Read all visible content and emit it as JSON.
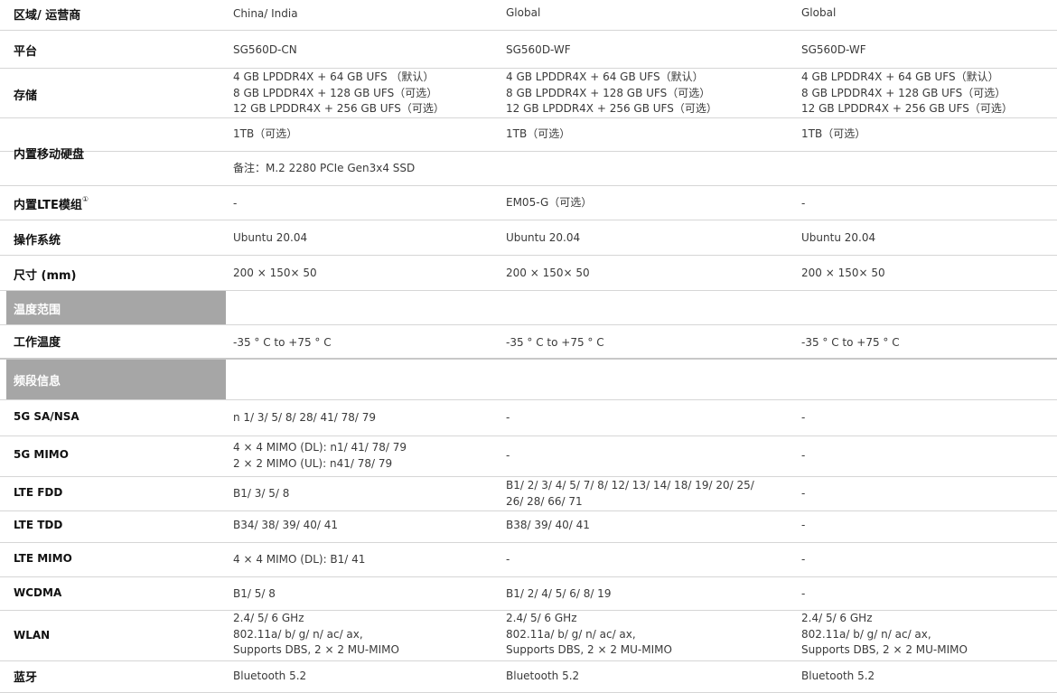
{
  "rows": {
    "region": {
      "label": "区域/ 运营商",
      "c1": "China/ India",
      "c2": "Global",
      "c3": "Global"
    },
    "platform": {
      "label": "平台",
      "c1": "SG560D-CN",
      "c2": "SG560D-WF",
      "c3": "SG560D-WF"
    },
    "storage": {
      "label": "存储",
      "c1": [
        "4 GB LPDDR4X + 64 GB UFS （默认）",
        "8 GB LPDDR4X + 128 GB UFS（可选）",
        "12 GB LPDDR4X + 256 GB UFS（可选）"
      ],
      "c2": [
        "4 GB LPDDR4X + 64 GB UFS（默认）",
        "8 GB LPDDR4X + 128 GB UFS（可选）",
        "12 GB LPDDR4X + 256 GB UFS（可选）"
      ],
      "c3": [
        "4 GB LPDDR4X + 64 GB UFS（默认）",
        "8 GB LPDDR4X + 128 GB UFS（可选）",
        "12 GB LPDDR4X + 256 GB UFS（可选）"
      ]
    },
    "disk": {
      "label": "内置移动硬盘",
      "c1": "1TB（可选）",
      "c2": "1TB（可选）",
      "c3": "1TB（可选）",
      "note": "备注：M.2 2280 PCIe Gen3x4 SSD"
    },
    "lte_module": {
      "label": "内置LTE模组",
      "mark": "①",
      "c1": "-",
      "c2": "EM05-G（可选）",
      "c3": "-"
    },
    "os": {
      "label": "操作系统",
      "c1": "Ubuntu 20.04",
      "c2": "Ubuntu 20.04",
      "c3": "Ubuntu 20.04"
    },
    "size": {
      "label": "尺寸 (mm)",
      "c1": "200 × 150× 50",
      "c2": "200 × 150× 50",
      "c3": "200 × 150× 50"
    },
    "temp_section": {
      "label": "温度范围"
    },
    "work_temp": {
      "label": "工作温度",
      "c1": "-35 ° C to +75 ° C",
      "c2": "-35 ° C to +75 ° C",
      "c3": "-35 ° C to +75 ° C"
    },
    "band_section": {
      "label": "频段信息"
    },
    "sa_nsa": {
      "label": "5G SA/NSA",
      "c1": "n 1/ 3/ 5/ 8/ 28/ 41/ 78/ 79",
      "c2": "-",
      "c3": "-"
    },
    "mimo5g": {
      "label": "5G MIMO",
      "c1": [
        "4 × 4 MIMO (DL): n1/ 41/ 78/ 79",
        "2 × 2 MIMO (UL): n41/ 78/ 79"
      ],
      "c2": "-",
      "c3": "-"
    },
    "lte_fdd": {
      "label": "LTE FDD",
      "c1": "B1/ 3/ 5/ 8",
      "c2": [
        "B1/ 2/ 3/ 4/ 5/ 7/ 8/ 12/ 13/ 14/ 18/ 19/ 20/ 25/",
        "26/  28/ 66/ 71"
      ],
      "c3": "-"
    },
    "lte_tdd": {
      "label": "LTE TDD",
      "c1": "B34/ 38/ 39/ 40/ 41",
      "c2": "B38/ 39/ 40/ 41",
      "c3": "-"
    },
    "lte_mimo": {
      "label": "LTE MIMO",
      "c1": "4 × 4 MIMO (DL): B1/ 41",
      "c2": "-",
      "c3": "-"
    },
    "wcdma": {
      "label": "WCDMA",
      "c1": "B1/ 5/ 8",
      "c2": "B1/ 2/ 4/ 5/ 6/ 8/ 19",
      "c3": "-"
    },
    "wlan": {
      "label": "WLAN",
      "c1": [
        "2.4/ 5/ 6 GHz",
        "802.11a/ b/ g/ n/ ac/ ax,",
        "Supports DBS, 2 × 2 MU-MIMO"
      ],
      "c2": [
        "2.4/ 5/ 6 GHz",
        "802.11a/ b/ g/ n/ ac/ ax,",
        "Supports DBS, 2 × 2 MU-MIMO"
      ],
      "c3": [
        "2.4/ 5/ 6 GHz",
        "802.11a/ b/ g/ n/ ac/ ax,",
        "Supports DBS, 2 × 2 MU-MIMO"
      ]
    },
    "bluetooth": {
      "label": "蓝牙",
      "c1": "Bluetooth 5.2",
      "c2": "Bluetooth 5.2",
      "c3": "Bluetooth 5.2"
    }
  }
}
